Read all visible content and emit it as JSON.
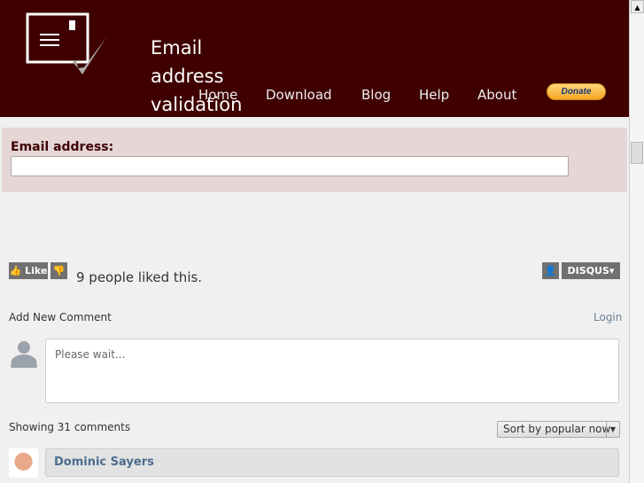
{
  "header": {
    "title": "Email address validation",
    "nav": [
      "Home",
      "Download",
      "Blog",
      "Help",
      "About"
    ],
    "donate": "Donate"
  },
  "form": {
    "label": "Email address:",
    "value": ""
  },
  "disqus": {
    "like": "Like",
    "liked_text": "9 people liked this.",
    "brand": "DISQUS",
    "add_comment": "Add New Comment",
    "login": "Login",
    "placeholder": "Please wait...",
    "showing": "Showing 31 comments",
    "sort": "Sort by popular now",
    "comments": [
      {
        "author": "Dominic Sayers"
      }
    ]
  },
  "colors": {
    "header_bg": "#3f0000",
    "form_bg": "#e6d6d6",
    "link": "#4e6d8f"
  }
}
